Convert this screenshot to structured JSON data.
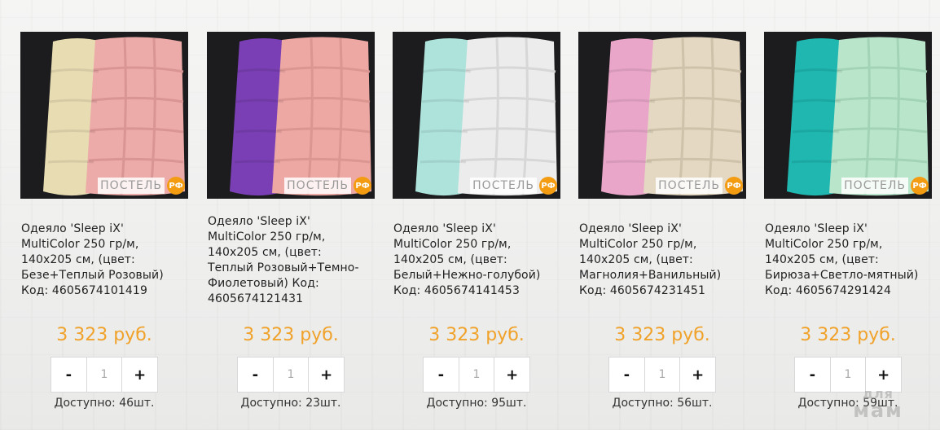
{
  "products": [
    {
      "title_lines": [
        "Одеяло 'Sleep iX'",
        "MultiColor 250 гр/м,",
        "140x205 см, (цвет:",
        "Безе+Теплый Розовый)",
        "Код: 4605674101419"
      ],
      "price": "3 323 руб.",
      "minus": "-",
      "qty": "1",
      "plus": "+",
      "stock": "Доступно: 46шт.",
      "colors": {
        "left": "#e8dcb2",
        "main": "#ecaaa8",
        "shadow": "#d99593"
      }
    },
    {
      "title_lines": [
        "Одеяло 'Sleep iX'",
        "MultiColor 250 гр/м,",
        "140x205 см, (цвет:",
        "Теплый Розовый+Темно-",
        "Фиолетовый) Код:",
        "4605674121431"
      ],
      "price": "3 323 руб.",
      "minus": "-",
      "qty": "1",
      "plus": "+",
      "stock": "Доступно: 23шт.",
      "colors": {
        "left": "#7a3fb4",
        "main": "#eea8a4",
        "shadow": "#dc9692"
      }
    },
    {
      "title_lines": [
        "Одеяло 'Sleep iX'",
        "MultiColor 250 гр/м,",
        "140x205 см, (цвет:",
        "Белый+Нежно-голубой)",
        "Код: 4605674141453"
      ],
      "price": "3 323 руб.",
      "minus": "-",
      "qty": "1",
      "plus": "+",
      "stock": "Доступно: 95шт.",
      "colors": {
        "left": "#aee3dc",
        "main": "#ececec",
        "shadow": "#d7d7d7"
      }
    },
    {
      "title_lines": [
        "Одеяло 'Sleep iX'",
        "MultiColor 250 гр/м,",
        "140x205 см, (цвет:",
        "Магнолия+Ванильный)",
        "Код: 4605674231451"
      ],
      "price": "3 323 руб.",
      "minus": "-",
      "qty": "1",
      "plus": "+",
      "stock": "Доступно: 56шт.",
      "colors": {
        "left": "#eaa6c9",
        "main": "#e4d8c2",
        "shadow": "#cfc2ab"
      }
    },
    {
      "title_lines": [
        "Одеяло 'Sleep iX'",
        "MultiColor 250 гр/м,",
        "140x205 см, (цвет:",
        "Бирюза+Светло-мятный)",
        "Код: 4605674291424"
      ],
      "price": "3 323 руб.",
      "minus": "-",
      "qty": "1",
      "plus": "+",
      "stock": "Доступно: 59шт.",
      "colors": {
        "left": "#1fb7b0",
        "main": "#b9e6cb",
        "shadow": "#a3d3b6"
      }
    }
  ],
  "image_watermark": {
    "text": "ПОСТЕЛЬ",
    "badge": "РФ"
  },
  "site_watermark": {
    "line1": "для",
    "line2": "мам"
  },
  "accent_color": "#f0a22a"
}
